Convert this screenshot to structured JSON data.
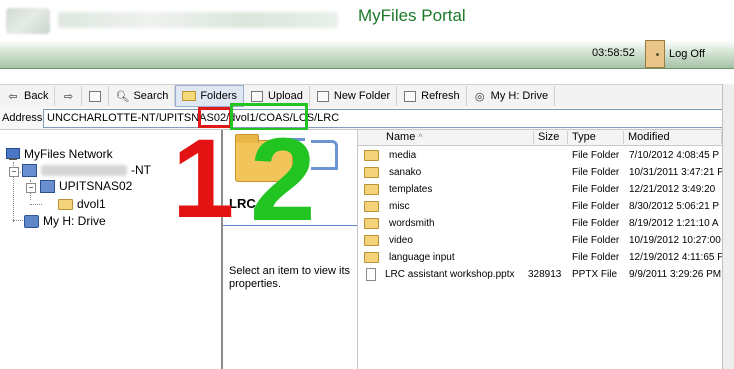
{
  "header": {
    "portal_title": "MyFiles Portal",
    "clock": "03:58:52",
    "logoff_label": "Log Off"
  },
  "toolbar": {
    "back": "Back",
    "forward": "",
    "up": "",
    "search": "Search",
    "folders": "Folders",
    "upload": "Upload",
    "new_folder": "New Folder",
    "refresh": "Refresh",
    "my_h_drive": "My H: Drive"
  },
  "address": {
    "label": "Address",
    "value": "UNCCHARLOTTE-NT/UPITSNAS02/dvol1/COAS/LCS/LRC"
  },
  "annotations": {
    "one": "1",
    "two": "2",
    "red_color": "#e01818",
    "green_color": "#21c421"
  },
  "tree": {
    "root": "MyFiles Network",
    "server_suffix": "-NT",
    "nas": "UPITSNAS02",
    "volume": "dvol1",
    "drive": "My H: Drive"
  },
  "preview": {
    "folder_name": "LRC",
    "hint": "Select an item to view its properties."
  },
  "file_list": {
    "columns": {
      "name": "Name",
      "size": "Size",
      "type": "Type",
      "modified": "Modified"
    },
    "rows": [
      {
        "name": "media",
        "size": "",
        "type": "File Folder",
        "modified": "7/10/2012 4:08:45 P"
      },
      {
        "name": "sanako",
        "size": "",
        "type": "File Folder",
        "modified": "10/31/2011 3:47:21 P"
      },
      {
        "name": "templates",
        "size": "",
        "type": "File Folder",
        "modified": "12/21/2012 3:49:20"
      },
      {
        "name": "misc",
        "size": "",
        "type": "File Folder",
        "modified": "8/30/2012 5:06:21 P"
      },
      {
        "name": "wordsmith",
        "size": "",
        "type": "File Folder",
        "modified": "8/19/2012 1:21:10 A"
      },
      {
        "name": "video",
        "size": "",
        "type": "File Folder",
        "modified": "10/19/2012 10:27:00"
      },
      {
        "name": "language input",
        "size": "",
        "type": "File Folder",
        "modified": "12/19/2012 4:11:65 P"
      },
      {
        "name": "LRC assistant workshop.pptx",
        "size": "328913",
        "type": "PPTX File",
        "modified": "9/9/2011 3:29:26 PM"
      }
    ]
  }
}
